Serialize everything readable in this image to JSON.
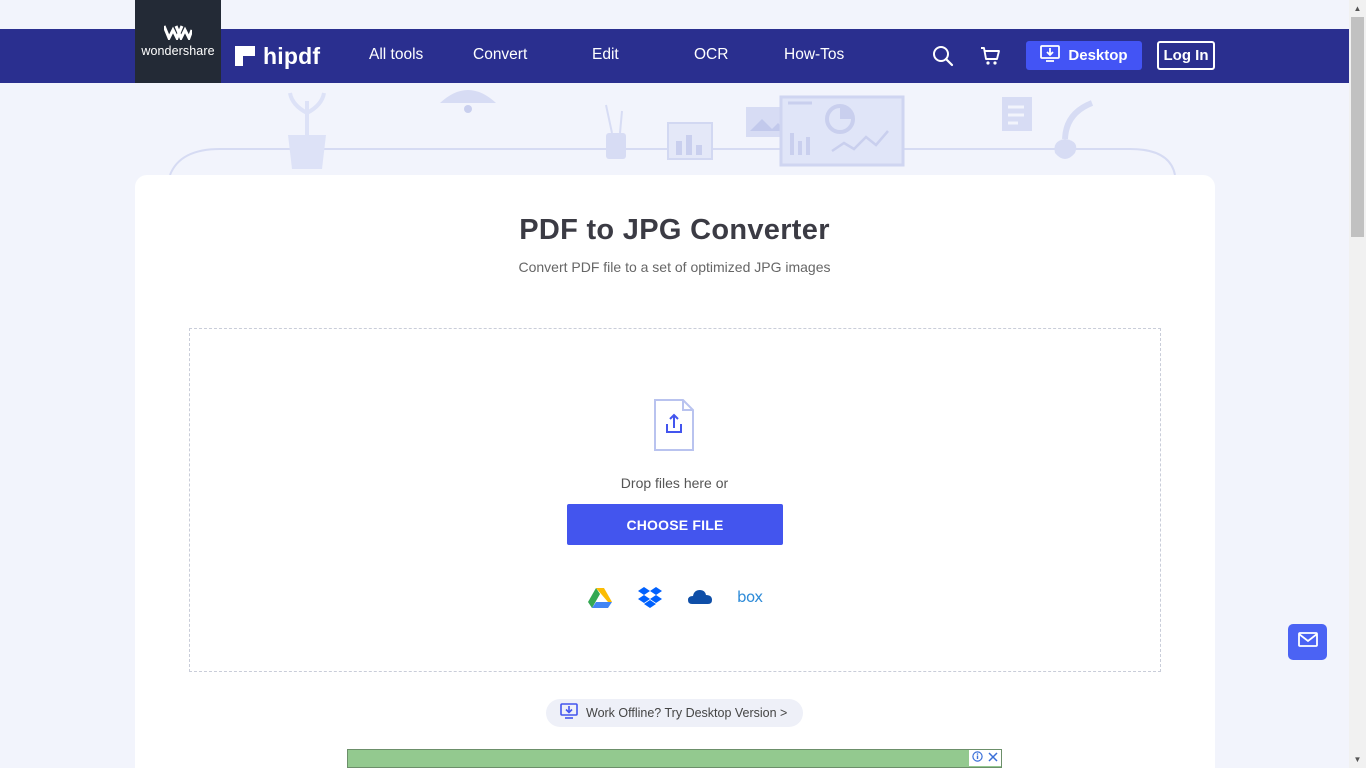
{
  "header": {
    "vendor_name": "wondershare",
    "brand_name": "hipdf",
    "nav": [
      {
        "label": "All tools"
      },
      {
        "label": "Convert"
      },
      {
        "label": "Edit"
      },
      {
        "label": "OCR"
      },
      {
        "label": "How-Tos"
      }
    ],
    "icons": [
      "search-icon",
      "cart-icon"
    ],
    "desktop_button": "Desktop",
    "login_button": "Log In"
  },
  "main": {
    "title": "PDF to JPG Converter",
    "subtitle": "Convert PDF file to a set of optimized JPG images",
    "drop_text": "Drop files here or",
    "choose_button": "CHOOSE FILE",
    "cloud_sources": [
      "google-drive-icon",
      "dropbox-icon",
      "onedrive-icon",
      "box-icon"
    ],
    "box_label": "box",
    "offline_text": "Work Offline? Try Desktop Version >"
  },
  "ad": {
    "icons": [
      "ad-info-icon",
      "ad-close-icon"
    ]
  },
  "colors": {
    "navbar": "#2a2f8f",
    "vendor_block": "#232a36",
    "accent": "#4355ee",
    "page_bg": "#f2f4fc"
  }
}
